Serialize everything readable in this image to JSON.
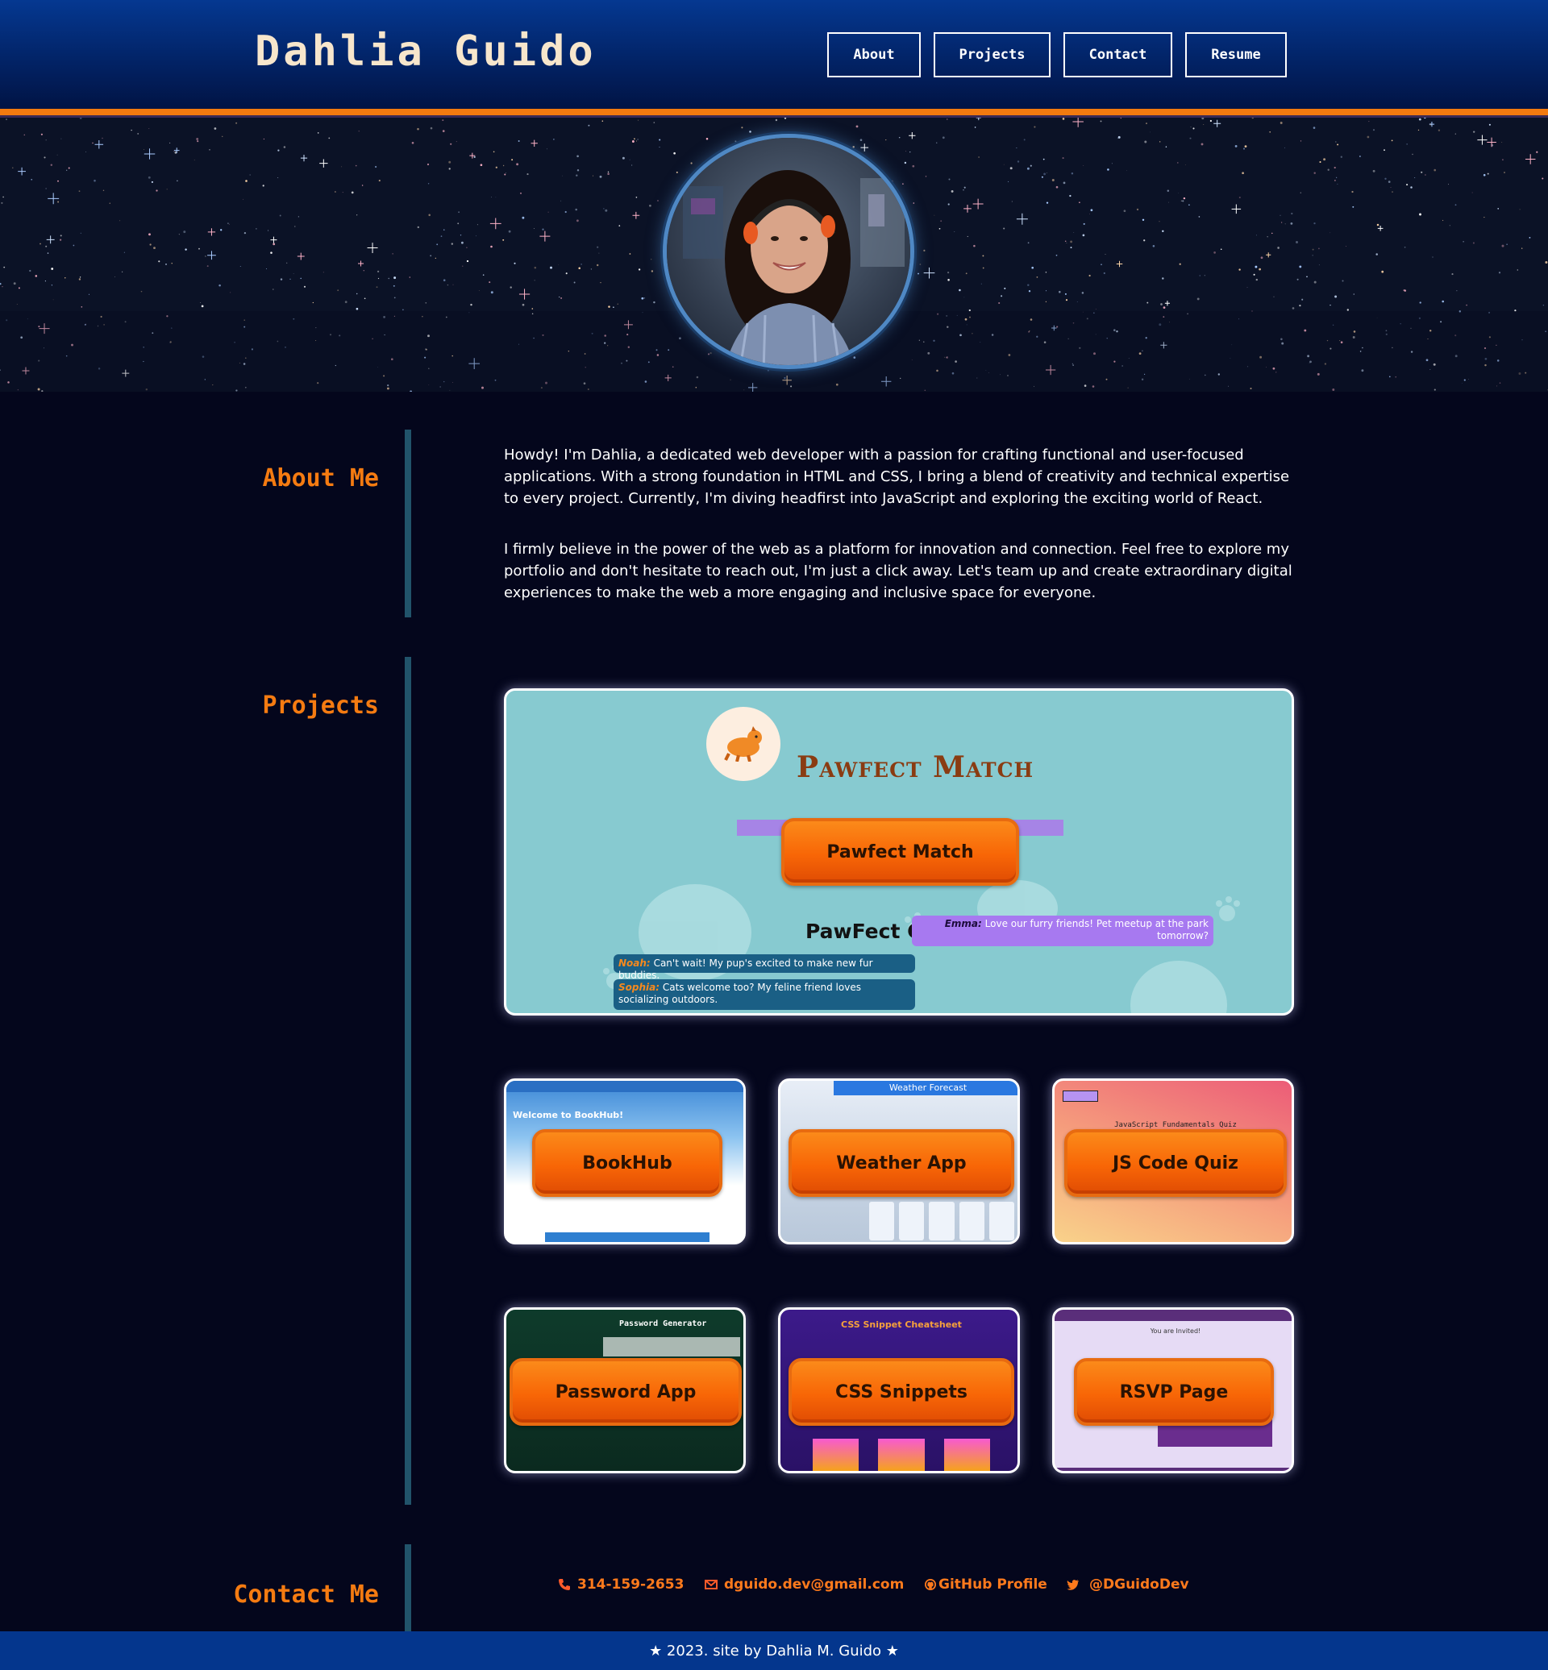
{
  "header": {
    "title": "Dahlia Guido",
    "nav": [
      {
        "label": "About"
      },
      {
        "label": "Projects"
      },
      {
        "label": "Contact"
      },
      {
        "label": "Resume"
      }
    ]
  },
  "hero": {
    "avatar_alt": "profile-photo"
  },
  "about": {
    "heading": "About Me",
    "paragraphs": [
      "Howdy! I'm Dahlia, a dedicated web developer with a passion for crafting functional and user-focused applications. With a strong foundation in HTML and CSS, I bring a blend of creativity and technical expertise to every project. Currently, I'm diving headfirst into JavaScript and exploring the exciting world of React.",
      "I firmly believe in the power of the web as a platform for innovation and connection. Feel free to explore my portfolio and don't hesitate to reach out, I'm just a click away. Let's team up and create extraordinary digital experiences to make the web a more engaging and inclusive space for everyone."
    ]
  },
  "projects": {
    "heading": "Projects",
    "featured": {
      "label": "Pawfect Match",
      "screenshot": {
        "brand": "Pawfect Match",
        "chat_title": "PawFect Chatroom",
        "messages": [
          {
            "name": "Emma:",
            "text": "Love our furry friends! Pet meetup at the park tomorrow?"
          },
          {
            "name": "Noah:",
            "text": "Can't wait! My pup's excited to make new fur buddies."
          },
          {
            "name": "Sophia:",
            "text": "Cats welcome too? My feline friend loves socializing outdoors."
          }
        ]
      }
    },
    "cards": [
      {
        "label": "BookHub",
        "thumb_text": "Welcome to BookHub!"
      },
      {
        "label": "Weather App",
        "thumb_text": "Weather Forecast"
      },
      {
        "label": "JS Code Quiz",
        "thumb_text": "JavaScript Fundamentals Quiz"
      },
      {
        "label": "Password App",
        "thumb_text": "Password Generator"
      },
      {
        "label": "CSS Snippets",
        "thumb_text": "CSS Snippet Cheatsheet"
      },
      {
        "label": "RSVP Page",
        "thumb_text": "You are Invited!"
      }
    ]
  },
  "contact": {
    "heading": "Contact Me",
    "links": [
      {
        "icon": "phone-icon",
        "label": "314-159-2653"
      },
      {
        "icon": "mail-icon",
        "label": "dguido.dev@gmail.com"
      },
      {
        "icon": "github-icon",
        "label": "GitHub Profile"
      },
      {
        "icon": "twitter-icon",
        "label": "@DGuidoDev"
      }
    ]
  },
  "footer": {
    "text": "★ 2023. site by Dahlia M. Guido ★"
  },
  "colors": {
    "accent": "#f57b11",
    "header": "#022366",
    "background": "#04061c",
    "footer": "#04368d"
  }
}
